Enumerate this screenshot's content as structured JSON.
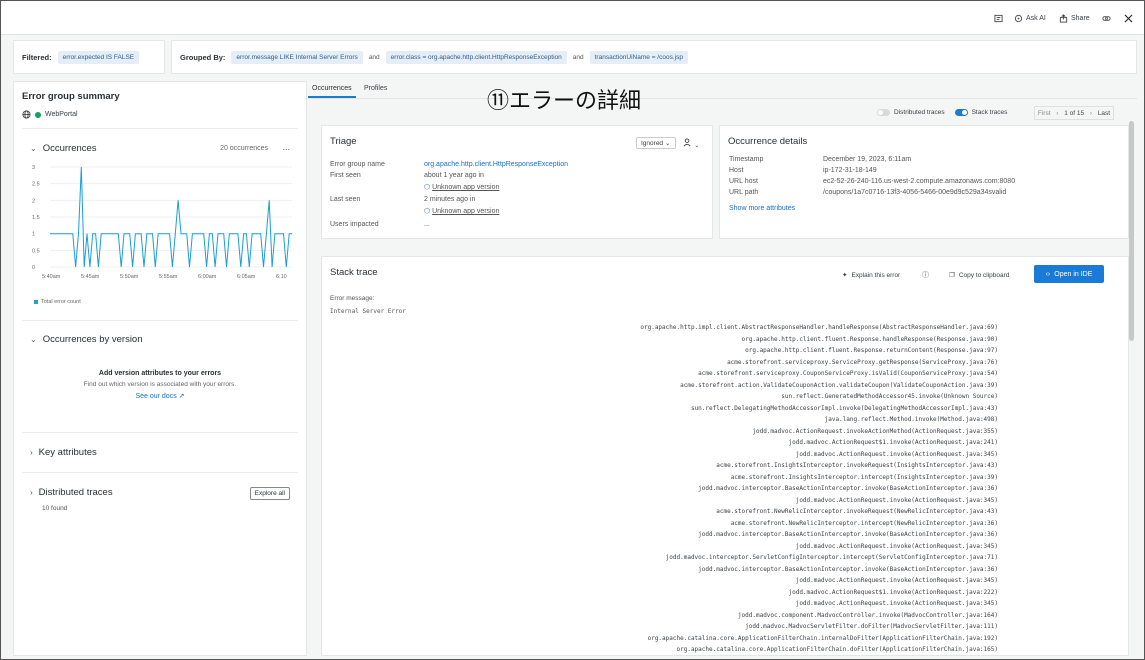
{
  "toolbar": {
    "ask_ai": "Ask AI",
    "share": "Share"
  },
  "filters": {
    "filtered_label": "Filtered:",
    "filtered_chip": "error.expected  IS FALSE",
    "grouped_label": "Grouped By:",
    "group_chips": [
      "error.message  LIKE  Internal Server Errors",
      "error.class  =  org.apache.http.client.HttpResponseException",
      "transactionUiName  =  /coos.jsp"
    ],
    "and_word": "and"
  },
  "summary": {
    "title": "Error group summary",
    "entity": "WebPortal",
    "occurrences_title": "Occurrences",
    "occurrences_count": "20 occurrences",
    "more": "...",
    "legend": "Total error count",
    "by_version_title": "Occurrences by version",
    "version_heading": "Add version attributes to your errors",
    "version_body": "Find out which version is associated with your errors.",
    "version_link": "See our docs",
    "key_attributes": "Key attributes",
    "distributed_traces": "Distributed traces",
    "traces_found": "10 found",
    "explore_all": "Explore all"
  },
  "chart_data": {
    "type": "line",
    "title": "",
    "x": [
      "5:40am",
      "5:45am",
      "5:50am",
      "5:55am",
      "6:00am",
      "6:05am",
      "6:10"
    ],
    "series": [
      {
        "name": "Total error count",
        "values": [
          1,
          1,
          1,
          1,
          1,
          1,
          1,
          1,
          1,
          0,
          1,
          3,
          0,
          1,
          0,
          1,
          1,
          0,
          1,
          1,
          1,
          1,
          1,
          1,
          1,
          0,
          1,
          1,
          1,
          0,
          1,
          1,
          1,
          0,
          1,
          1,
          1,
          0,
          1,
          1,
          1,
          1,
          1,
          0,
          1,
          2,
          1,
          1,
          1,
          0,
          1,
          1,
          1,
          1,
          1,
          0,
          1,
          1,
          0,
          1,
          1,
          1,
          0,
          1,
          1,
          1,
          1,
          0,
          1,
          1,
          0,
          1,
          1,
          1,
          1,
          0,
          1,
          2,
          0,
          1,
          1,
          1,
          1,
          0,
          1,
          1
        ]
      }
    ],
    "yticks": [
      "3",
      "2.5",
      "2",
      "1.5",
      "1",
      "0.5",
      "0"
    ],
    "ylim": [
      0,
      3
    ],
    "color": "#1a9fd6"
  },
  "tabs": [
    "Occurrences",
    "Profiles"
  ],
  "annotation": "⑪エラーの詳細",
  "controls": {
    "distributed_traces": "Distributed traces",
    "stack_traces": "Stack traces",
    "first": "First",
    "page": "1 of 15",
    "last": "Last"
  },
  "triage": {
    "title": "Triage",
    "status": "Ignored",
    "rows": [
      {
        "label": "Error group name",
        "value": "org.apache.http.client.HttpResponseException"
      },
      {
        "label": "First seen",
        "value": "about 1 year ago in"
      },
      {
        "label": "",
        "value": "Unknown app version"
      },
      {
        "label": "Last seen",
        "value": "2 minutes ago in"
      },
      {
        "label": "",
        "value": "Unknown app version"
      },
      {
        "label": "Users impacted",
        "value": "..."
      }
    ]
  },
  "occurrence": {
    "title": "Occurrence details",
    "rows": [
      {
        "label": "Timestamp",
        "value": "December 19, 2023, 6:11am"
      },
      {
        "label": "Host",
        "value": "ip-172-31-18-149"
      },
      {
        "label": "URL host",
        "value": "ec2-52-26-240-116.us-west-2.compute.amazonaws.com:8080"
      },
      {
        "label": "URL path",
        "value": "/coupons/1a7c0716-13f3-4056-5466-00e9d9c529a34svalid"
      }
    ],
    "more": "Show more attributes"
  },
  "stack": {
    "title": "Stack trace",
    "explain": "Explain this error",
    "copy": "Copy to clipboard",
    "open_ide": "Open in IDE",
    "error_label": "Error message:",
    "error_message": "Internal Server Error",
    "lines": [
      "org.apache.http.impl.client.AbstractResponseHandler.handleResponse(AbstractResponseHandler.java:69)",
      "org.apache.http.client.fluent.Response.handleResponse(Response.java:90)",
      "org.apache.http.client.fluent.Response.returnContent(Response.java:97)",
      "acme.storefront.serviceproxy.ServiceProxy.getResponse(ServiceProxy.java:76)",
      "acme.storefront.serviceproxy.CouponServiceProxy.isValid(CouponServiceProxy.java:54)",
      "acme.storefront.action.ValidateCouponAction.validateCoupon(ValidateCouponAction.java:39)",
      "sun.reflect.GeneratedMethodAccessor45.invoke(Unknown Source)",
      "sun.reflect.DelegatingMethodAccessorImpl.invoke(DelegatingMethodAccessorImpl.java:43)",
      "java.lang.reflect.Method.invoke(Method.java:498)",
      "jodd.madvoc.ActionRequest.invokeActionMethod(ActionRequest.java:355)",
      "jodd.madvoc.ActionRequest$1.invoke(ActionRequest.java:241)",
      "jodd.madvoc.ActionRequest.invoke(ActionRequest.java:345)",
      "acme.storefront.InsightsInterceptor.invokeRequest(InsightsInterceptor.java:43)",
      "acme.storefront.InsightsInterceptor.intercept(InsightsInterceptor.java:39)",
      "jodd.madvoc.interceptor.BaseActionInterceptor.invoke(BaseActionInterceptor.java:36)",
      "jodd.madvoc.ActionRequest.invoke(ActionRequest.java:345)",
      "acme.storefront.NewRelicInterceptor.invokeRequest(NewRelicInterceptor.java:43)",
      "acme.storefront.NewRelicInterceptor.intercept(NewRelicInterceptor.java:36)",
      "jodd.madvoc.interceptor.BaseActionInterceptor.invoke(BaseActionInterceptor.java:36)",
      "jodd.madvoc.ActionRequest.invoke(ActionRequest.java:345)",
      "jodd.madvoc.interceptor.ServletConfigInterceptor.intercept(ServletConfigInterceptor.java:71)",
      "jodd.madvoc.interceptor.BaseActionInterceptor.invoke(BaseActionInterceptor.java:36)",
      "jodd.madvoc.ActionRequest.invoke(ActionRequest.java:345)",
      "jodd.madvoc.ActionRequest$1.invoke(ActionRequest.java:222)",
      "jodd.madvoc.ActionRequest.invoke(ActionRequest.java:345)",
      "jodd.madvoc.component.MadvocController.invoke(MadvocController.java:164)",
      "jodd.madvoc.MadvocServletFilter.doFilter(MadvocServletFilter.java:111)",
      "org.apache.catalina.core.ApplicationFilterChain.internalDoFilter(ApplicationFilterChain.java:192)",
      "org.apache.catalina.core.ApplicationFilterChain.doFilter(ApplicationFilterChain.java:165)"
    ]
  }
}
